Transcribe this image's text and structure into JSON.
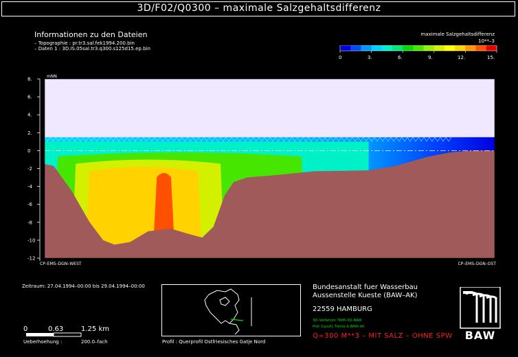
{
  "title": "3D/F02/Q0300 – maximale Salzgehaltsdifferenz",
  "info": {
    "heading": "Informationen zu den Dateien",
    "lines": [
      "– Topographie : pr.tr3.sal.fek1994.200.bin",
      "– Daten 1 : 3D.IS.05sal.tr3.q300.s125d15.ep.bin"
    ]
  },
  "legend": {
    "title": "maximale Salzgehaltsdifferenz",
    "unit": "10**–3",
    "ticks": [
      "0",
      "3.",
      "6.",
      "9.",
      "12.",
      "15."
    ],
    "colors": [
      "#0000e0",
      "#0046ff",
      "#0096ff",
      "#00d2ff",
      "#00f0c8",
      "#00e678",
      "#00dc00",
      "#46e600",
      "#96f000",
      "#d2f000",
      "#ffff00",
      "#ffd200",
      "#ff9600",
      "#ff5000",
      "#e60000"
    ]
  },
  "chart_data": {
    "type": "heatmap",
    "title": "3D/F02/Q0300 – maximale Salzgehaltsdifferenz",
    "ylabel": "mNN",
    "ylim": [
      -12,
      8
    ],
    "yticks": [
      "8.",
      "6.",
      "4.",
      "2.",
      "0",
      "-2",
      "-4",
      "-6",
      "-8",
      "-10",
      "-12"
    ],
    "x_start_label": "CP–EMS–DGN–WEST",
    "x_end_label": "CP–EMS–DGN–OST",
    "colorbar": {
      "label": "maximale Salzgehaltsdifferenz",
      "unit": "10**–3",
      "range": [
        0,
        15
      ]
    },
    "water_level": 0,
    "bed_profile": [
      [
        0.0,
        -1.5
      ],
      [
        0.02,
        -1.7
      ],
      [
        0.06,
        -4.5
      ],
      [
        0.1,
        -8.0
      ],
      [
        0.13,
        -10.0
      ],
      [
        0.155,
        -10.5
      ],
      [
        0.19,
        -10.2
      ],
      [
        0.23,
        -9.0
      ],
      [
        0.28,
        -8.7
      ],
      [
        0.32,
        -9.3
      ],
      [
        0.35,
        -9.7
      ],
      [
        0.375,
        -8.5
      ],
      [
        0.4,
        -5.0
      ],
      [
        0.42,
        -3.5
      ],
      [
        0.45,
        -3.0
      ],
      [
        0.52,
        -2.7
      ],
      [
        0.6,
        -2.3
      ],
      [
        0.72,
        -2.2
      ],
      [
        0.78,
        -1.7
      ],
      [
        0.85,
        -0.7
      ],
      [
        0.9,
        -0.2
      ],
      [
        0.95,
        0.0
      ],
      [
        1.0,
        0.0
      ]
    ],
    "zones": [
      {
        "x": [
          0.02,
          0.58
        ],
        "ymax": -0.2,
        "value": 7.5
      },
      {
        "x": [
          0.06,
          0.4
        ],
        "ymax": -1.0,
        "value": 9.5
      },
      {
        "x": [
          0.09,
          0.35
        ],
        "ymax": -1.8,
        "value": 11.0
      },
      {
        "x": [
          0.24,
          0.29
        ],
        "ymax": -2.5,
        "value": 13.0
      }
    ]
  },
  "bottom": {
    "period": "Zeitraum: 27.04.1994–00:00 bis 29.04.1994–00:00",
    "scale_labels": [
      "0",
      "0.63",
      "1.25 km"
    ],
    "exag_label": "Ueberhoehung :",
    "exag_value": "200.0–fach",
    "profile_label": "Profil : Querprofil Ostfriesisches Gatje Nord"
  },
  "institution": {
    "line1": "Bundesanstalt fuer Wasserbau",
    "line2": "Aussenstelle Kueste (BAW–AK)",
    "line3": "22559 HAMBURG",
    "tiny1": "3D–Verfahren TRIM–3D–BAW",
    "tiny2": "Prof. Casulli, Trento & BAW–AK",
    "note": "Q=300 M**3 – MIT SALZ – OHNE SPW",
    "logo": "BAW"
  }
}
